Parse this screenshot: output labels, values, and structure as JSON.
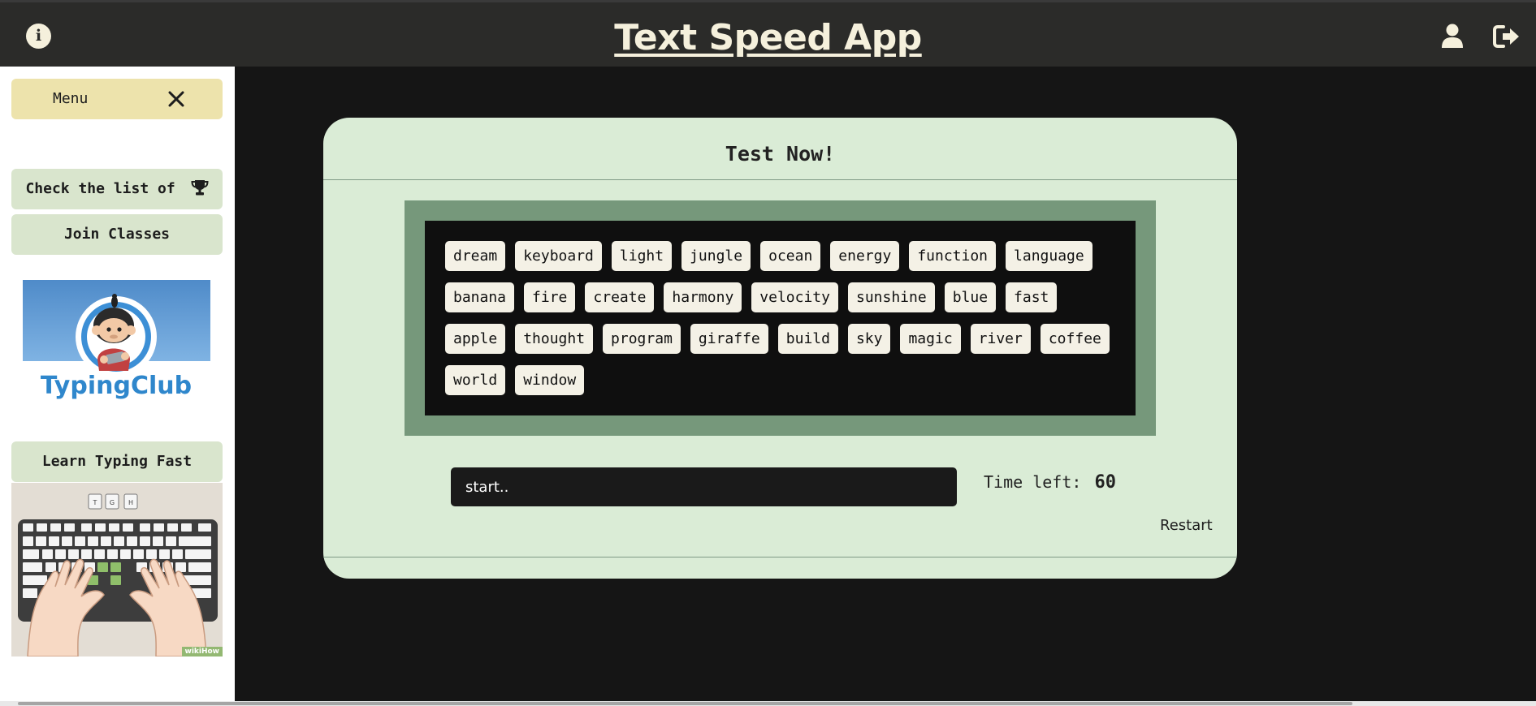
{
  "header": {
    "info_glyph": "i",
    "title": "Text Speed App",
    "icons": [
      "info-icon",
      "user-icon",
      "logout-icon"
    ]
  },
  "sidebar": {
    "menu_label": "Menu",
    "close_icon": "close-icon",
    "leaderboard_label": "Check the list of",
    "leaderboard_icon": "trophy-icon",
    "classes_label": "Join Classes",
    "promo_brand": "TypingClub",
    "learn_label": "Learn Typing Fast",
    "keyboard_keys_top": [
      "T",
      "G",
      "H"
    ],
    "watermark": "wikiHow"
  },
  "test": {
    "title": "Test Now!",
    "words": [
      "dream",
      "keyboard",
      "light",
      "jungle",
      "ocean",
      "energy",
      "function",
      "language",
      "banana",
      "fire",
      "create",
      "harmony",
      "velocity",
      "sunshine",
      "blue",
      "fast",
      "apple",
      "thought",
      "program",
      "giraffe",
      "build",
      "sky",
      "magic",
      "river",
      "coffee",
      "world",
      "window"
    ],
    "input_placeholder": "start..",
    "input_value": "",
    "time_label": "Time left:",
    "time_value": "60",
    "restart_label": "Restart"
  },
  "colors": {
    "topbar": "#2b2b29",
    "background": "#151515",
    "card": "#daecd6",
    "words_frame": "#76987b",
    "word_chip": "#f4f1e6",
    "menu": "#ede3ac",
    "side_button": "#d9e5cd"
  }
}
